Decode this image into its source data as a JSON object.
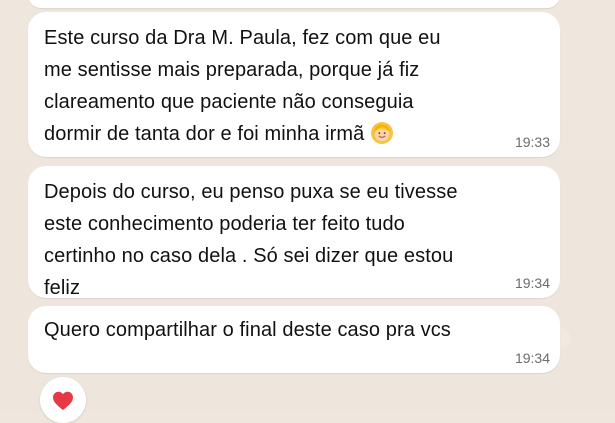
{
  "messages": [
    {
      "text": "Este curso da Dra M. Paula, fez com que eu\nme sentisse mais preparada, porque já fiz\nclareamento que paciente não conseguia\ndormir de tanta dor e foi minha irmã",
      "time": "19:33",
      "emoji": "blonde-girl"
    },
    {
      "text": "Depois do curso, eu penso puxa se eu tivesse\neste conhecimento poderia ter feito tudo\ncertinho no caso dela . Só sei dizer que estou\nfeliz",
      "time": "19:34"
    },
    {
      "text": "Quero compartilhar o final deste caso pra vcs",
      "time": "19:34"
    }
  ],
  "reaction": {
    "icon": "heart-icon",
    "color": "#e53945"
  },
  "colors": {
    "background": "#efe7de",
    "bubble": "#ffffff",
    "text": "#111111",
    "time": "#6b6b6b"
  }
}
